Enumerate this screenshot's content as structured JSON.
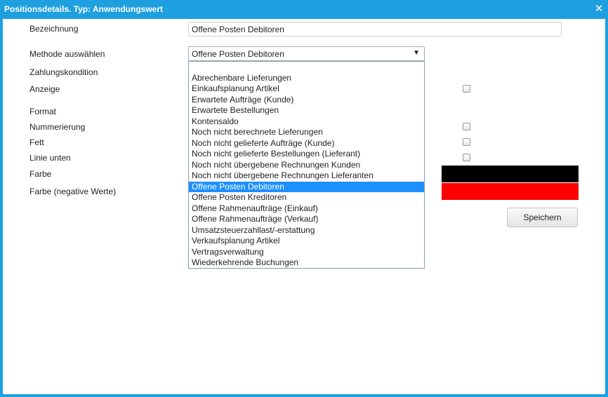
{
  "window": {
    "title": "Positionsdetails. Typ: Anwendungswert",
    "close_glyph": "✕"
  },
  "labels": {
    "bezeichnung": "Bezeichnung",
    "methode": "Methode auswählen",
    "zahlungskondition": "Zahlungskondition",
    "anzeige": "Anzeige",
    "format": "Format",
    "nummerierung": "Nummerierung",
    "fett": "Fett",
    "linie_unten": "Linie unten",
    "farbe": "Farbe",
    "farbe_negativ": "Farbe (negative Werte)"
  },
  "fields": {
    "bezeichnung_value": "Offene Posten Debitoren",
    "methode_selected": "Offene Posten Debitoren",
    "arrow_glyph": "▼"
  },
  "dropdown": {
    "options": [
      "",
      "Abrechenbare Lieferungen",
      "Einkaufsplanung Artikel",
      "Erwartete Aufträge (Kunde)",
      "Erwartete Bestellungen",
      "Kontensaldo",
      "Noch nicht berechnete Lieferungen",
      "Noch nicht gelieferte Aufträge (Kunde)",
      "Noch nicht gelieferte Bestellungen (Lieferant)",
      "Noch nicht übergebene Rechnungen Kunden",
      "Noch nicht übergebene Rechnungen Lieferanten",
      "Offene Posten Debitoren",
      "Offene Posten Kreditoren",
      "Offene Rahmenaufträge (Einkauf)",
      "Offene Rahmenaufträge (Verkauf)",
      "Umsatzsteuerzahllast/-erstattung",
      "Verkaufsplanung Artikel",
      "Vertragsverwaltung",
      "Wiederkehrende Buchungen"
    ],
    "selected_index": 11
  },
  "checkboxes": {
    "anzeige": false,
    "nummerierung": false,
    "fett": false,
    "linie_unten": false
  },
  "colors": {
    "accent": "#1e9fe0",
    "farbe": "#000000",
    "farbe_negativ": "#ff0000",
    "selection": "#1e90ff"
  },
  "buttons": {
    "save": "Speichern"
  }
}
